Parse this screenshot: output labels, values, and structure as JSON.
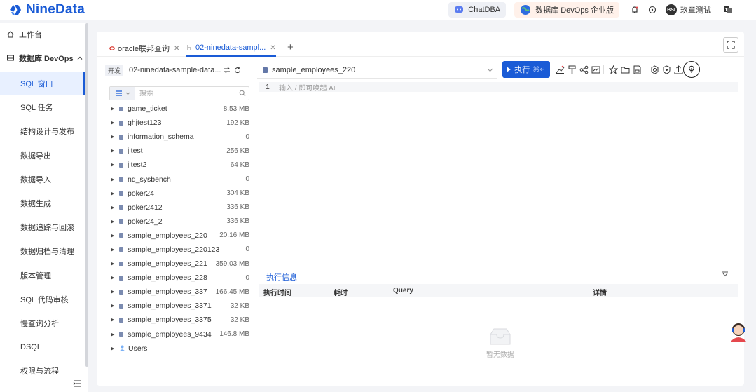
{
  "header": {
    "logo": "NineData",
    "chatdba": "ChatDBA",
    "devops_edition": "数据库 DevOps 企业版",
    "avatar_initials": "BSI",
    "username": "玖章测试"
  },
  "sidebar": {
    "workbench": "工作台",
    "devops_group": "数据库 DevOps",
    "items": [
      {
        "label": "SQL 窗口",
        "active": true
      },
      {
        "label": "SQL 任务"
      },
      {
        "label": "结构设计与发布"
      },
      {
        "label": "数据导出"
      },
      {
        "label": "数据导入"
      },
      {
        "label": "数据生成"
      },
      {
        "label": "数据追踪与回滚"
      },
      {
        "label": "数据归档与清理"
      },
      {
        "label": "版本管理"
      },
      {
        "label": "SQL 代码审核"
      },
      {
        "label": "慢查询分析"
      },
      {
        "label": "DSQL"
      },
      {
        "label": "权限与流程"
      }
    ]
  },
  "tabs": [
    {
      "label": "oracle联邦查询"
    },
    {
      "label": "02-ninedata-sampl...",
      "active": true
    }
  ],
  "db_selector": {
    "env": "开发",
    "name": "02-ninedata-sample-data..."
  },
  "datasource": {
    "selected": "sample_employees_220"
  },
  "toolbar": {
    "run_label": "执行",
    "run_shortcut": "⌘↵"
  },
  "tree_search": {
    "placeholder": "搜索"
  },
  "databases": [
    {
      "name": "game_ticket",
      "size": "8.53 MB"
    },
    {
      "name": "ghjtest123",
      "size": "192 KB"
    },
    {
      "name": "information_schema",
      "size": "0"
    },
    {
      "name": "jltest",
      "size": "256 KB"
    },
    {
      "name": "jltest2",
      "size": "64 KB"
    },
    {
      "name": "nd_sysbench",
      "size": "0"
    },
    {
      "name": "poker24",
      "size": "304 KB"
    },
    {
      "name": "poker2412",
      "size": "336 KB"
    },
    {
      "name": "poker24_2",
      "size": "336 KB"
    },
    {
      "name": "sample_employees_220",
      "size": "20.16 MB"
    },
    {
      "name": "sample_employees_220123",
      "size": "0"
    },
    {
      "name": "sample_employees_221",
      "size": "359.03 MB"
    },
    {
      "name": "sample_employees_228",
      "size": "0"
    },
    {
      "name": "sample_employees_337",
      "size": "166.45 MB"
    },
    {
      "name": "sample_employees_3371",
      "size": "32 KB"
    },
    {
      "name": "sample_employees_3375",
      "size": "32 KB"
    },
    {
      "name": "sample_employees_9434",
      "size": "146.8 MB"
    },
    {
      "name": "Users",
      "size": "",
      "is_users": true
    }
  ],
  "editor": {
    "line_number": "1",
    "placeholder": "输入 / 即可唤起 AI"
  },
  "results": {
    "tab": "执行信息",
    "columns": [
      "执行时间",
      "耗时",
      "Query",
      "详情"
    ],
    "empty_text": "暂无数据"
  },
  "colors": {
    "brand": "#1a5bd6",
    "panel": "#ffffff",
    "background": "#f3f4f7"
  }
}
